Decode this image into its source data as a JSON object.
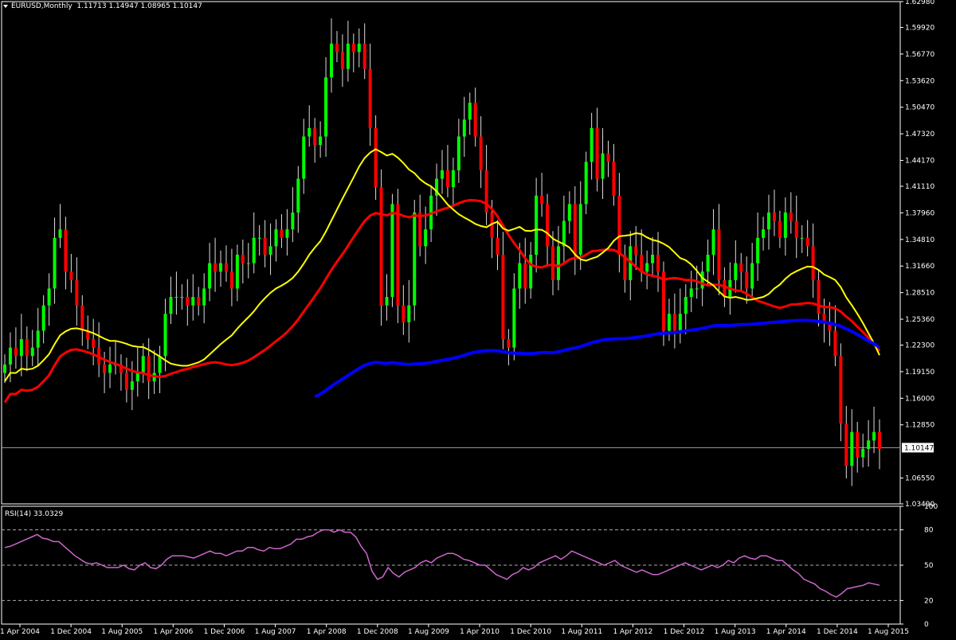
{
  "header": {
    "symbol": "EURUSD,Monthly",
    "ohlc": "1.11713 1.14947 1.08965 1.10147"
  },
  "colors": {
    "bull": "#00ff00",
    "bullBody": "#90ee90",
    "bear": "#ff0000",
    "bearBody": "#ff3333",
    "ma_yellow": "#ffff00",
    "ma_red": "#ff0000",
    "ma_blue": "#0000ff",
    "rsi": "#cc66cc",
    "grid": "#ffffff",
    "axis": "#ffffff"
  },
  "chart_data": [
    {
      "type": "candlestick",
      "title": "EURUSD,Monthly",
      "ylim": [
        1.0349,
        1.6298
      ],
      "y_ticks": [
        "1.62980",
        "1.59920",
        "1.56770",
        "1.53620",
        "1.50470",
        "1.47320",
        "1.44170",
        "1.41110",
        "1.37960",
        "1.34810",
        "1.31660",
        "1.28510",
        "1.25360",
        "1.22300",
        "1.19150",
        "1.16000",
        "1.12850",
        "1.10147",
        "1.06550",
        "1.03490"
      ],
      "x_ticks": [
        "1 Apr 2004",
        "1 Dec 2004",
        "1 Aug 2005",
        "1 Apr 2006",
        "1 Dec 2006",
        "1 Aug 2007",
        "1 Apr 2008",
        "1 Dec 2008",
        "1 Aug 2009",
        "1 Apr 2010",
        "1 Dec 2010",
        "1 Aug 2011",
        "1 Apr 2012",
        "1 Dec 2012",
        "1 Aug 2013",
        "1 Apr 2014",
        "1 Dec 2014",
        "1 Aug 2015"
      ],
      "current_price": "1.10147",
      "closes": [
        1.2,
        1.22,
        1.21,
        1.23,
        1.21,
        1.22,
        1.24,
        1.27,
        1.29,
        1.35,
        1.36,
        1.31,
        1.3,
        1.27,
        1.24,
        1.23,
        1.22,
        1.2,
        1.19,
        1.2,
        1.2,
        1.19,
        1.17,
        1.18,
        1.19,
        1.21,
        1.18,
        1.19,
        1.21,
        1.26,
        1.28,
        1.28,
        1.28,
        1.27,
        1.28,
        1.27,
        1.29,
        1.32,
        1.31,
        1.32,
        1.31,
        1.29,
        1.33,
        1.32,
        1.32,
        1.35,
        1.35,
        1.33,
        1.34,
        1.36,
        1.35,
        1.36,
        1.38,
        1.42,
        1.47,
        1.48,
        1.46,
        1.47,
        1.54,
        1.58,
        1.57,
        1.55,
        1.58,
        1.57,
        1.58,
        1.55,
        1.48,
        1.41,
        1.27,
        1.28,
        1.39,
        1.27,
        1.25,
        1.27,
        1.38,
        1.34,
        1.36,
        1.4,
        1.42,
        1.43,
        1.41,
        1.43,
        1.47,
        1.49,
        1.51,
        1.47,
        1.43,
        1.38,
        1.35,
        1.33,
        1.23,
        1.22,
        1.29,
        1.32,
        1.29,
        1.33,
        1.4,
        1.39,
        1.34,
        1.3,
        1.34,
        1.37,
        1.39,
        1.33,
        1.39,
        1.44,
        1.48,
        1.42,
        1.45,
        1.44,
        1.4,
        1.33,
        1.3,
        1.34,
        1.33,
        1.31,
        1.32,
        1.33,
        1.31,
        1.24,
        1.26,
        1.24,
        1.26,
        1.28,
        1.29,
        1.29,
        1.31,
        1.33,
        1.36,
        1.3,
        1.28,
        1.3,
        1.32,
        1.31,
        1.29,
        1.32,
        1.35,
        1.36,
        1.38,
        1.37,
        1.35,
        1.38,
        1.37,
        1.35,
        1.35,
        1.34,
        1.3,
        1.26,
        1.25,
        1.24,
        1.21,
        1.13,
        1.08,
        1.12,
        1.09,
        1.1,
        1.11,
        1.12,
        1.1
      ]
    },
    {
      "type": "line",
      "title": "RSI(14) 33.0329",
      "ylim": [
        0,
        100
      ],
      "y_ticks": [
        "100",
        "80",
        "50",
        "20",
        "0"
      ],
      "levels": [
        80,
        50,
        20
      ],
      "values": [
        65,
        66,
        68,
        70,
        72,
        74,
        76,
        73,
        72,
        70,
        70,
        66,
        62,
        58,
        55,
        52,
        51,
        52,
        50,
        48,
        48,
        48,
        50,
        47,
        46,
        50,
        52,
        48,
        47,
        50,
        55,
        58,
        58,
        58,
        57,
        56,
        58,
        60,
        62,
        60,
        60,
        58,
        60,
        62,
        62,
        65,
        65,
        63,
        62,
        65,
        64,
        64,
        66,
        68,
        72,
        72,
        74,
        75,
        78,
        80,
        80,
        78,
        80,
        78,
        78,
        74,
        66,
        60,
        45,
        38,
        40,
        48,
        43,
        40,
        44,
        46,
        48,
        52,
        54,
        52,
        56,
        58,
        60,
        60,
        58,
        55,
        54,
        52,
        50,
        50,
        46,
        42,
        40,
        38,
        42,
        44,
        48,
        46,
        48,
        52,
        54,
        56,
        58,
        55,
        58,
        62,
        60,
        58,
        56,
        54,
        52,
        50,
        52,
        54,
        50,
        48,
        46,
        44,
        46,
        44,
        42,
        42,
        44,
        46,
        48,
        50,
        52,
        50,
        48,
        46,
        48,
        50,
        48,
        50,
        54,
        52,
        56,
        58,
        56,
        55,
        58,
        58,
        56,
        54,
        54,
        50,
        46,
        43,
        38,
        36,
        34,
        30,
        28,
        25,
        23,
        26,
        30,
        31,
        32,
        33,
        35,
        34,
        33
      ]
    }
  ]
}
